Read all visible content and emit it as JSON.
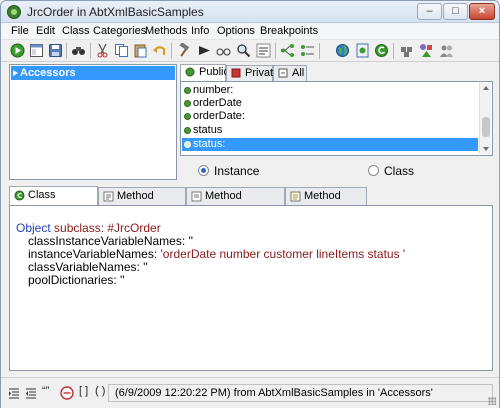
{
  "window": {
    "title": "JrcOrder in AbtXmlBasicSamples"
  },
  "menu": {
    "items": [
      "File",
      "Edit",
      "Class",
      "Categories",
      "Methods",
      "Info",
      "Options",
      "Breakpoints"
    ]
  },
  "toolbar": {
    "icons": [
      "run-icon",
      "browse-icon",
      "save-icon",
      "binoculars-icon",
      "cut-icon",
      "copy-icon",
      "paste-icon",
      "undo-icon",
      "hammer-icon",
      "run-arrow-icon",
      "glasses-icon",
      "magnifier-icon",
      "references-icon",
      "hierarchy-icon",
      "sort-icon",
      "globe-icon",
      "class-icon",
      "reload-icon",
      "inspect-icon",
      "shapes-icon",
      "people-icon"
    ]
  },
  "categories": {
    "items": [
      {
        "label": "Accessors",
        "selected": true
      }
    ]
  },
  "method_tabs": [
    {
      "label": "Public",
      "active": true
    },
    {
      "label": "Private",
      "active": false
    },
    {
      "label": "All",
      "active": false
    }
  ],
  "methods": [
    {
      "label": "number:",
      "selected": false
    },
    {
      "label": "orderDate",
      "selected": false
    },
    {
      "label": "orderDate:",
      "selected": false
    },
    {
      "label": "status",
      "selected": false
    },
    {
      "label": "status:",
      "selected": true
    }
  ],
  "side": {
    "instance_label": "Instance",
    "class_label": "Class",
    "selected": "Instance"
  },
  "bottom_tabs": [
    {
      "label": "Class Definition",
      "active": true
    },
    {
      "label": "Method Source",
      "active": false
    },
    {
      "label": "Method Comment",
      "active": false
    },
    {
      "label": "Method Notes",
      "active": false
    }
  ],
  "source": {
    "line1_kw": "Object",
    "line1_rest": " subclass: #JrcOrder",
    "line2": "classInstanceVariableNames: ''",
    "line3_a": "instanceVariableNames: ",
    "line3_str": "'orderDate number customer lineItems status '",
    "line4": "classVariableNames: ''",
    "line5": "poolDictionaries: ''"
  },
  "statusbar": {
    "text": "(6/9/2009 12:20:22 PM) from AbtXmlBasicSamples in 'Accessors'"
  },
  "colors": {
    "selection": "#3399ff",
    "method_dot": "#4a9a3a",
    "keyword": "#1f3fb8",
    "string": "#8a1a1a"
  }
}
